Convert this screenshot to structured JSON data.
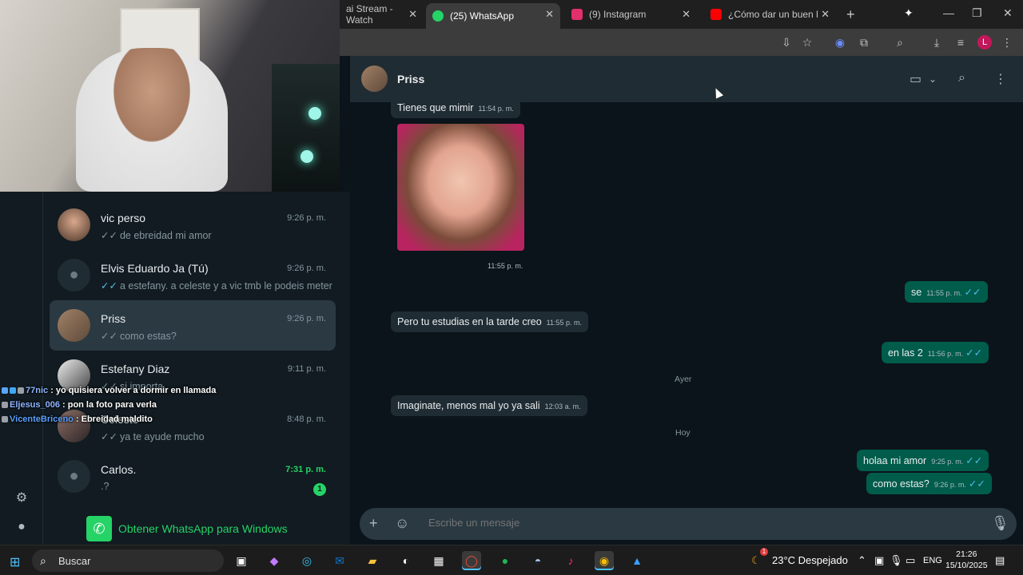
{
  "browser": {
    "tabs": [
      {
        "title": "ai Stream - Watch",
        "icon": "stream-icon",
        "color": "#9147ff"
      },
      {
        "title": "(25) WhatsApp",
        "icon": "whatsapp-icon",
        "color": "#25d366"
      },
      {
        "title": "(9) Instagram",
        "icon": "instagram-icon",
        "color": "#e1306c"
      },
      {
        "title": "¿Cómo dar un buen beso",
        "icon": "youtube-icon",
        "color": "#ff0000"
      }
    ],
    "profile_initial": "L"
  },
  "sidebar": {
    "chats": [
      {
        "name": "vic perso",
        "time": "9:26 p. m.",
        "preview": "de ebreidad mi amor",
        "ticks": "✓✓",
        "ticks_read": false
      },
      {
        "name": "Elvis Eduardo Ja (Tú)",
        "time": "9:26 p. m.",
        "preview": "a estefany. a celeste y a vic tmb le podeis meter",
        "ticks": "✓✓",
        "ticks_read": true
      },
      {
        "name": "Priss",
        "time": "9:26 p. m.",
        "preview": "como estas?",
        "ticks": "✓✓",
        "ticks_read": false
      },
      {
        "name": "Estefany Diaz",
        "time": "9:11 p. m.",
        "preview": "si importa",
        "ticks": "✓✓",
        "ticks_read": false
      },
      {
        "name": "Celeste",
        "time": "8:48 p. m.",
        "preview": "ya te ayude mucho",
        "ticks": "✓✓",
        "ticks_read": false
      },
      {
        "name": "Carlos.",
        "time": "7:31 p. m.",
        "preview": ".?",
        "ticks": "",
        "ticks_read": false,
        "unread": "1"
      }
    ],
    "get_app_label": "Obtener WhatsApp para Windows"
  },
  "stream_chat": [
    {
      "user": "77nic",
      "msg": ": yo quisiera volver a dormir en llamada"
    },
    {
      "user": "Eljesus_006",
      "msg": ": pon la foto para verla"
    },
    {
      "user": "VicenteBriceno",
      "msg": ": Ebreidad maldito"
    }
  ],
  "conversation": {
    "contact_name": "Priss",
    "messages": [
      {
        "dir": "in",
        "text": "Tienes que mimir",
        "time": "11:54 p. m."
      },
      {
        "dir": "in",
        "type": "image",
        "time": "11:55 p. m."
      },
      {
        "dir": "out",
        "text": "se",
        "time": "11:55 p. m."
      },
      {
        "dir": "in",
        "text": "Pero tu estudias en la tarde creo",
        "time": "11:55 p. m."
      },
      {
        "dir": "out",
        "text": "en las 2",
        "time": "11:56 p. m."
      },
      {
        "dir": "in",
        "text": "Imaginate, menos mal yo ya sali",
        "time": "12:03 a. m."
      },
      {
        "dir": "out",
        "text": "holaa mi amor",
        "time": "9:25 p. m."
      },
      {
        "dir": "out",
        "text": "como estas?",
        "time": "9:26 p. m."
      }
    ],
    "day_separators": [
      "Ayer",
      "Hoy"
    ],
    "composer_placeholder": "Escribe un mensaje"
  },
  "taskbar": {
    "search_label": "Buscar",
    "weather": "23°C Despejado",
    "weather_badge": "1",
    "language": "ENG",
    "time": "21:26",
    "date": "15/10/2025"
  },
  "colors": {
    "whatsapp_green": "#25d366",
    "outgoing_bubble": "#005c4b",
    "incoming_bubble": "#202c33",
    "read_tick": "#53bdeb"
  }
}
